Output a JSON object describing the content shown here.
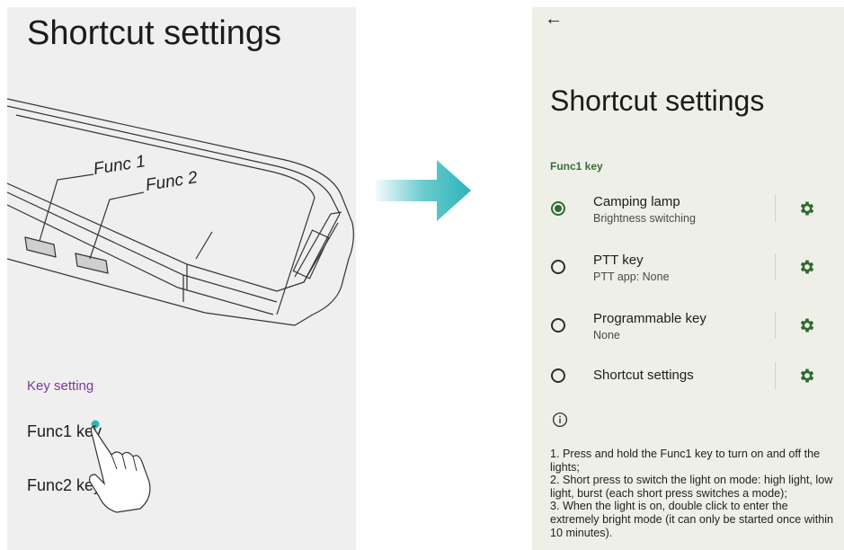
{
  "left": {
    "title": "Shortcut settings",
    "func1_label": "Func 1",
    "func2_label": "Func 2",
    "section_header": "Key setting",
    "items": [
      "Func1 key",
      "Func2 key"
    ]
  },
  "right": {
    "back_icon": "back-arrow-icon",
    "back_glyph": "←",
    "title": "Shortcut settings",
    "section_header": "Func1 key",
    "options": [
      {
        "title": "Camping lamp",
        "subtitle": "Brightness switching",
        "selected": true
      },
      {
        "title": "PTT key",
        "subtitle": "PTT app: None",
        "selected": false
      },
      {
        "title": "Programmable key",
        "subtitle": "None",
        "selected": false
      },
      {
        "title": "Shortcut settings",
        "subtitle": "",
        "selected": false
      }
    ],
    "notes": [
      "1. Press and hold the Func1 key to turn on and off the lights;",
      "2. Short press to switch the light on mode: high light, low light, burst (each short press switches a mode);",
      "3. When the light is on, double click to enter the extremely bright mode (it can only be started once within 10 minutes)."
    ]
  },
  "colors": {
    "accent_green": "#2f6b2f",
    "section_purple": "#7a3a9a",
    "arrow_teal": "#2bb5b8",
    "right_bg": "#eef0e8",
    "left_bg": "#efefef"
  }
}
